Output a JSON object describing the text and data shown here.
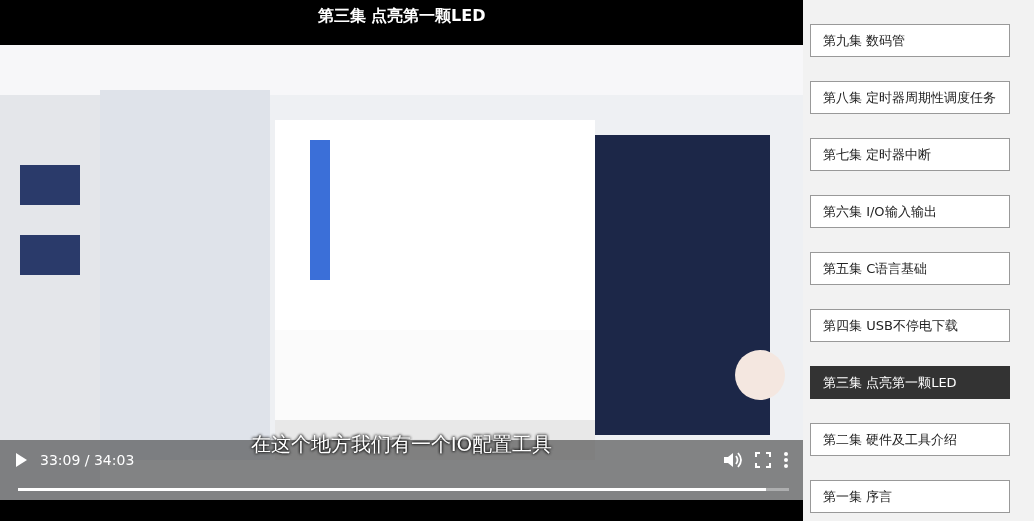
{
  "player": {
    "title": "第三集 点亮第一颗LED",
    "subtitle": "在这个地方我们有一个IO配置工具",
    "time": "33:09 / 34:03",
    "progress": {
      "level": 0.97
    }
  },
  "episodes": [
    {
      "label": "第九集 数码管",
      "selected": false
    },
    {
      "label": "第八集 定时器周期性调度任务",
      "selected": false
    },
    {
      "label": "第七集 定时器中断",
      "selected": false
    },
    {
      "label": "第六集 I/O输入输出",
      "selected": false
    },
    {
      "label": "第五集 C语言基础",
      "selected": false
    },
    {
      "label": "第四集 USB不停电下载",
      "selected": false
    },
    {
      "label": "第三集 点亮第一颗LED",
      "selected": true
    },
    {
      "label": "第二集 硬件及工具介绍",
      "selected": false
    },
    {
      "label": "第一集 序言",
      "selected": false
    }
  ]
}
